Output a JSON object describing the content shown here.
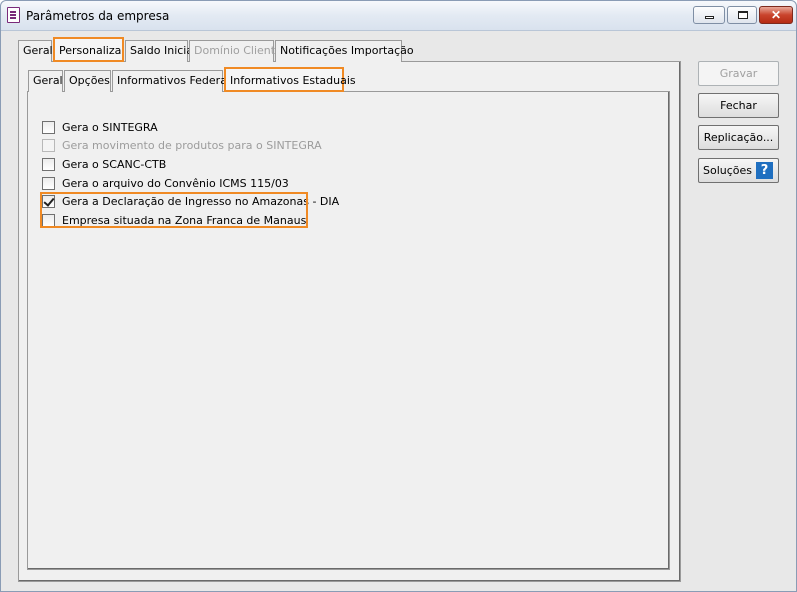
{
  "window": {
    "title": "Parâmetros da empresa"
  },
  "outer_tabs": [
    {
      "label": "Geral"
    },
    {
      "label": "Personaliza"
    },
    {
      "label": "Saldo Inicial"
    },
    {
      "label": "Domínio Cliente"
    },
    {
      "label": "Notificações Importação"
    }
  ],
  "inner_tabs": [
    {
      "label": "Geral"
    },
    {
      "label": "Opções"
    },
    {
      "label": "Informativos Federais"
    },
    {
      "label": "Informativos Estaduais"
    }
  ],
  "checkboxes": [
    {
      "label": "Gera o SINTEGRA",
      "checked": false,
      "enabled": true
    },
    {
      "label": "Gera movimento de produtos para o SINTEGRA",
      "checked": false,
      "enabled": false
    },
    {
      "label": "Gera o SCANC-CTB",
      "checked": false,
      "enabled": true
    },
    {
      "label": "Gera o arquivo do Convênio ICMS 115/03",
      "checked": false,
      "enabled": true
    },
    {
      "label": "Gera a Declaração de Ingresso no Amazonas - DIA",
      "checked": true,
      "enabled": true
    },
    {
      "label": "Empresa situada na Zona Franca de Manaus",
      "checked": false,
      "enabled": true
    }
  ],
  "buttons": {
    "save": "Gravar",
    "close": "Fechar",
    "replicate": "Replicação...",
    "solutions": "Soluções"
  },
  "icons": {
    "help": "?",
    "close_window": "✕"
  },
  "colors": {
    "highlight": "#f08a24",
    "help_icon": "#1f6fc0",
    "close_button": "#c9432c"
  }
}
